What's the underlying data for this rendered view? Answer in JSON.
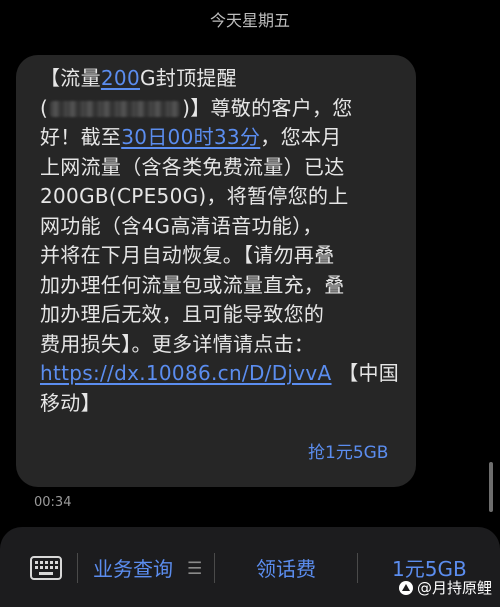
{
  "header": {
    "date": "今天星期五"
  },
  "message": {
    "line1_a": "【流量",
    "line1_link": "200",
    "line1_b": "G封顶提醒",
    "line2_open": "(",
    "line2_close": ")】尊敬的客户，您",
    "line3_a": "好！截至",
    "line3_link": "30日00时33分",
    "line3_b": "，您本月",
    "line4": "上网流量（含各类免费流量）已达",
    "line5": "200GB(CPE50G)，将暂停您的上",
    "line6": "网功能（含4G高清语音功能），",
    "line7": "并将在下月自动恢复。【请勿再叠",
    "line8": "加办理任何流量包或流量直充，叠",
    "line9": "加办理后无效，且可能导致您的",
    "line10": "费用损失】。更多详情请点击：",
    "link_url": "https://dx.10086.cn/D/DjvvA",
    "line11_b": " 【中国",
    "line12": "移动】",
    "action_label": "抢1元5GB"
  },
  "timestamp": "00:34",
  "bottom_bar": {
    "keyboard_icon": "keyboard-icon",
    "menu_glyph": "☰",
    "btn1": "业务查询",
    "btn2": "领话费",
    "btn3": "1元5GB"
  },
  "watermark": {
    "text": "@月持原鲤"
  },
  "colors": {
    "background": "#000000",
    "bubble": "#262626",
    "link": "#5b8def",
    "text": "#e6e6e6",
    "bar": "#1c1c1e"
  }
}
